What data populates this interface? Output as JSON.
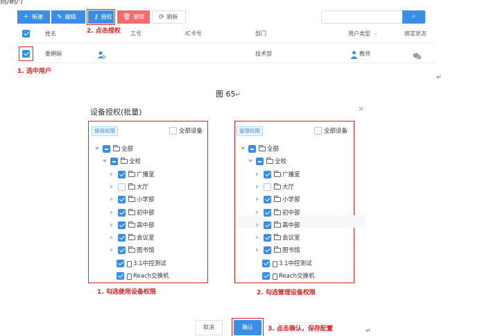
{
  "top_text": "则/刷/·/",
  "toolbar": {
    "new_label": "新建",
    "edit_label": "编辑",
    "auth_label": "授权",
    "delete_label": "删除",
    "refresh_label": "刷新"
  },
  "table": {
    "headers": [
      "姓名",
      "工号",
      "IC卡号",
      "部门",
      "用户类型",
      "绑定状态"
    ],
    "row": {
      "name": "姜婀娴",
      "dept": "技术部",
      "user_type": "教师"
    }
  },
  "annotations": {
    "select_user": "1. 选中用户",
    "click_auth": "2. 点击授权",
    "check_use": "1. 勾选使用设备权限",
    "check_manage": "2. 勾选管理设备权限",
    "confirm": "3. 点击确认，保存配置"
  },
  "figure_caption": "图 65",
  "dialog": {
    "title": "设备授权(批量)",
    "close": "×",
    "use_tab": "使用权限",
    "manage_tab": "管理权限",
    "all_devices": "全部设备",
    "cancel": "取消",
    "confirm": "确认",
    "tree": [
      "全部",
      "全校",
      "广播室",
      "大厅",
      "小学部",
      "初中部",
      "高中部",
      "会议室",
      "图书馆",
      "3.1中控测试",
      "Reach交换机"
    ]
  },
  "colors": {
    "accent": "#3a8ee6",
    "danger": "#f56c6c",
    "annotation": "#e02020"
  }
}
